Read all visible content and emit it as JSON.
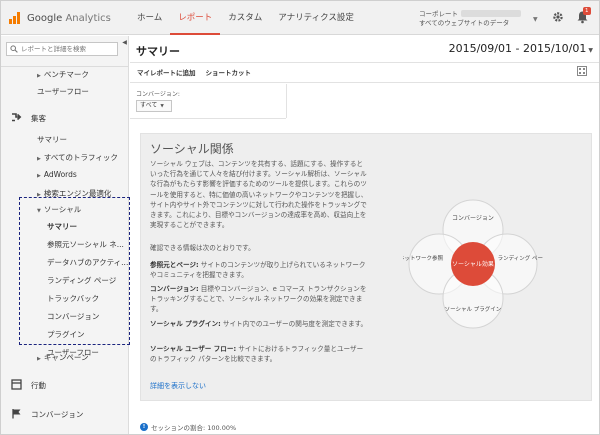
{
  "header": {
    "logo_text_brand": "Google",
    "logo_text_product": "Analytics",
    "nav": [
      "ホーム",
      "レポート",
      "カスタム",
      "アナリティクス設定"
    ],
    "account_line1": "コーポレート",
    "account_line2": "すべてのウェブサイトのデータ",
    "notification_count": "1"
  },
  "sidebar": {
    "search_placeholder": "レポートと詳細を検索",
    "items": {
      "benchmark": "ベンチマーク",
      "user_flow_top": "ユーザーフロー",
      "acquisition": "集客",
      "summary": "サマリー",
      "all_traffic": "すべてのトラフィック",
      "adwords": "AdWords",
      "search_engine": "検索エンジン最適化",
      "social": "ソーシャル",
      "social_summary": "サマリー",
      "social_network_ref": "参照元ソーシャル ネ...",
      "data_hub": "データハブのアクティ...",
      "landing_page": "ランディング ページ",
      "trackback": "トラックバック",
      "conversion": "コンバージョン",
      "plugin": "プラグイン",
      "user_flow": "ユーザーフロー",
      "campaign": "キャンペーン",
      "behavior": "行動",
      "conversions": "コンバージョン"
    }
  },
  "main": {
    "title": "サマリー",
    "date_range": "2015/09/01 - 2015/10/01",
    "actions": [
      "マイレポートに追加",
      "ショートカット"
    ],
    "conversion_label": "コンバージョン:",
    "conversion_select": "すべて",
    "panel": {
      "title": "ソーシャル関係",
      "intro": "ソーシャル ウェブは、コンテンツを共有する、話題にする、操作するといった行為を通じて人々を結び付けます。ソーシャル解析は、ソーシャルな行為がもたらす影響を評価するためのツールを提供します。これらのツールを使用すると、特に価値の高いネットワークやコンテンツを把握し、サイト内やサイト外でコンテンツに対して行われた操作をトラッキングできます。これにより、目標やコンバージョンの達成率を高め、収益向上を実現することができます。",
      "confirm": "確認できる情報は次のとおりです。",
      "p1_label": "参照元とページ:",
      "p1_text": " サイトのコンテンツが取り上げられているネットワークやコミュニティを把握できます。",
      "p2_label": "コンバージョン:",
      "p2_text": " 目標やコンバージョン、e コマース トランザクションをトラッキングすることで、ソーシャル ネットワークの効果を測定できます。",
      "p3_label": "ソーシャル プラグイン:",
      "p3_text": " サイト内でのユーザーの関与度を測定できます。",
      "p4_label": "ソーシャル ユーザー フロー:",
      "p4_text": " サイトにおけるトラフィック量とユーザーのトラフィック パターンを比較できます。",
      "details_link": "詳細を表示しない",
      "venn": {
        "top": "コンバージョン",
        "left": "ネットワーク参照",
        "right": "ランディング ページ",
        "bottom": "ソーシャル プラグイン",
        "center": "ソーシャル効果"
      }
    },
    "session_note": "セッションの割合: 100.00%"
  },
  "colors": {
    "accent": "#dd4b39",
    "link": "#1a6fc9",
    "highlight_box": "#1a237e"
  }
}
